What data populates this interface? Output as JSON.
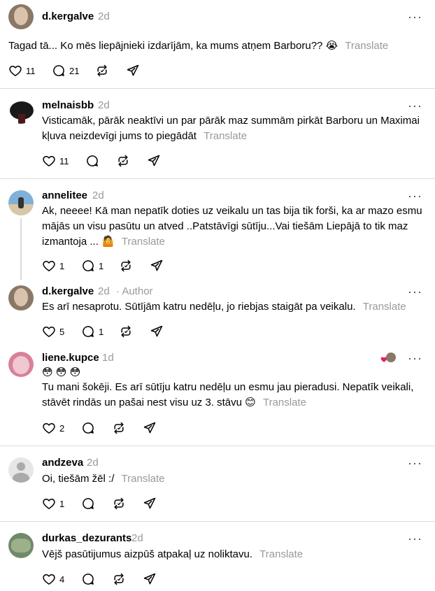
{
  "translate_label": "Translate",
  "more_glyph": "···",
  "posts": [
    {
      "user": "d.kergalve",
      "time": "2d",
      "text": "Tagad tā... Ko mēs liepājnieki izdarījām, ka mums atņem Barboru??",
      "emoji": "😭",
      "likes": "11",
      "replies": "21",
      "avatar_color": "#8a7766"
    },
    {
      "user": "melnaisbb",
      "time": "2d",
      "text": "Visticamāk, pārāk neaktīvi un par pārāk maz summām pirkāt Barboru un Maximai kļuva neizdevīgi jums to piegādāt",
      "likes": "11",
      "avatar_color": "#1a1a1a"
    },
    {
      "user": "annelitee",
      "time": "2d",
      "text": "Ak, neeee! Kā man nepatīk doties uz veikalu un tas bija tik forši, ka ar mazo esmu mājās un visu pasūtu un atved ..Patstāvīgi sūtīju...Vai tiešām Liepājā to tik maz izmantoja ...",
      "emoji": "🤷",
      "likes": "1",
      "replies": "1",
      "avatar_color": "#7fb0d8"
    },
    {
      "user": "d.kergalve",
      "time": "2d",
      "author_label": "· Author",
      "text": "Es arī nesaprotu. Sūtījām katru nedēļu, jo riebjas staigāt pa veikalu.",
      "likes": "5",
      "replies": "1",
      "avatar_color": "#8a7766"
    },
    {
      "user": "liene.kupce",
      "time": "1d",
      "emoji_row": "😳 😳 😳",
      "text": "Tu mani šokēji. Es arī sūtīju katru nedēļu un esmu jau pieradusi. Nepatīk veikali, stāvēt rindās un pašai nest visu uz 3. stāvu",
      "emoji": "😊",
      "likes": "2",
      "liked_by_icon": "heart-icon",
      "avatar_color": "#d9809a"
    },
    {
      "user": "andzeva",
      "time": "2d",
      "text": "Oi, tiešām žēl :/",
      "likes": "1",
      "avatar_color": "#c8c8c8"
    },
    {
      "user": "durkas_dezurants",
      "time": "2d",
      "text": "Vējš pasūtijumus aizpūš atpakaļ uz noliktavu.",
      "likes": "4",
      "avatar_color": "#6f8a6a"
    }
  ],
  "colors": {
    "muted": "#999999",
    "divider": "#dbdbdb",
    "heart": "#e0245e"
  }
}
